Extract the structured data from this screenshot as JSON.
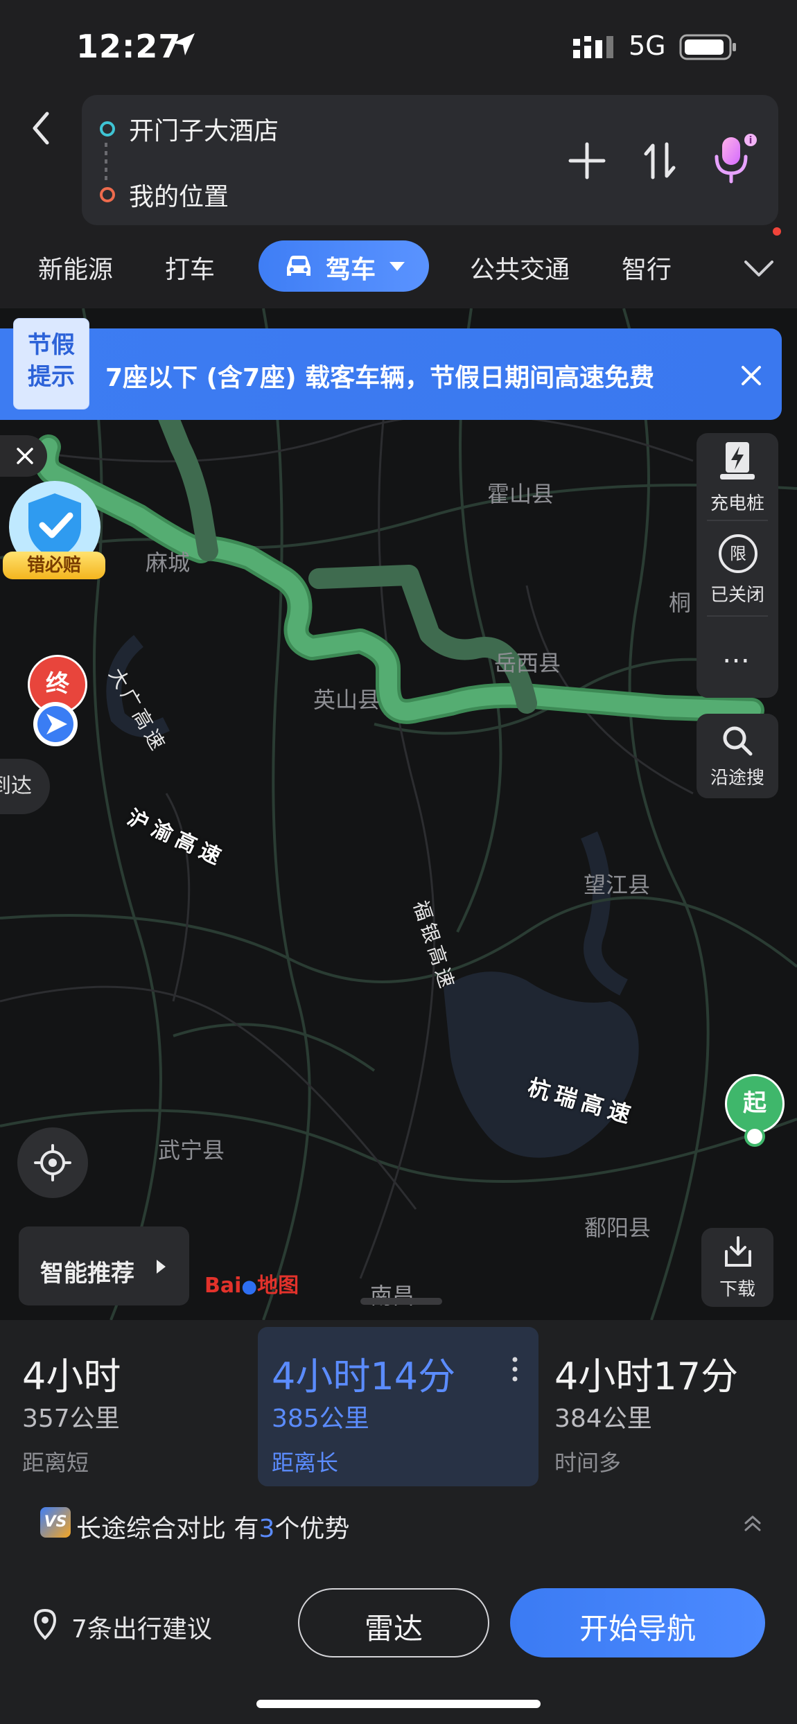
{
  "status_bar": {
    "time": "12:27",
    "network": "5G"
  },
  "search": {
    "destination": "开门子大酒店",
    "origin": "我的位置"
  },
  "modes": {
    "items": [
      "新能源",
      "打车",
      "驾车",
      "公共交通",
      "智行"
    ],
    "active": "驾车"
  },
  "banner": {
    "tag": "节假提示",
    "text": "7座以下 (含7座) 载客车辆，节假日期间高速免费"
  },
  "badge": {
    "label": "错必赔"
  },
  "toolbar": {
    "charging": "充电桩",
    "limit_icon": "限",
    "limit": "已关闭",
    "more": "…",
    "search_along": "沿途搜",
    "download": "下载"
  },
  "map": {
    "places": [
      "霍山县",
      "麻城",
      "岳西县",
      "英山县",
      "望江县",
      "武宁县",
      "鄱阳县",
      "南昌",
      "桐"
    ],
    "roads": [
      "沪渝高速",
      "大广高速",
      "福银高速",
      "杭瑞高速"
    ],
    "start_label": "起",
    "end_label": "终",
    "arrive_label": "到达",
    "logo": "Bai地图"
  },
  "smart": {
    "label": "智能推荐"
  },
  "routes": [
    {
      "time": "4小时",
      "distance": "357公里",
      "tag": "距离短",
      "selected": false
    },
    {
      "time": "4小时14分",
      "distance": "385公里",
      "tag": "距离长",
      "selected": true
    },
    {
      "time": "4小时17分",
      "distance": "384公里",
      "tag": "时间多",
      "selected": false
    }
  ],
  "compare": {
    "prefix": "长途综合对比 有",
    "count": "3",
    "suffix": "个优势",
    "icon_text": "VS"
  },
  "actions": {
    "tips": "7条出行建议",
    "radar": "雷达",
    "navigate": "开始导航"
  },
  "colors": {
    "accent": "#3f7ef5",
    "route": "#4fa86d",
    "selected_time": "#5b8cff"
  }
}
